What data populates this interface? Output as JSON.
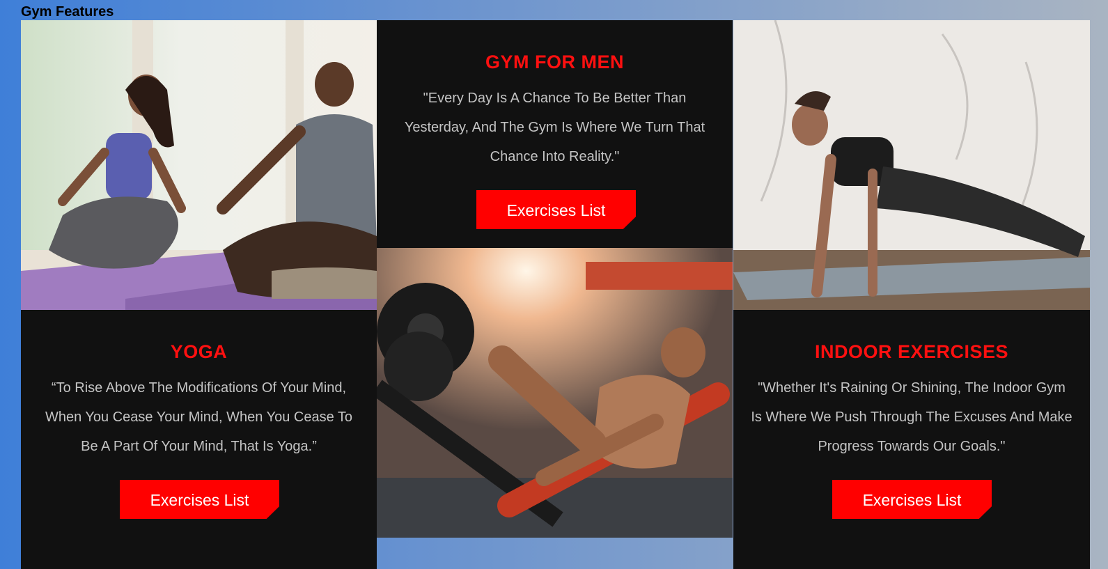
{
  "page": {
    "title": "Gym Features"
  },
  "cards": {
    "gym_for_men": {
      "title": "GYM FOR MEN",
      "quote": "\"Every Day Is A Chance To Be Better Than Yesterday, And The Gym Is Where We Turn That Chance Into Reality.\"",
      "button_label": "Exercises List"
    },
    "yoga": {
      "title": "YOGA",
      "quote": "“To Rise Above The Modifications Of Your Mind, When You Cease Your Mind, When You Cease To Be A Part Of Your Mind, That Is Yoga.”",
      "button_label": "Exercises List"
    },
    "indoor_exercises": {
      "title": "INDOOR EXERCISES",
      "quote": "\"Whether It's Raining Or Shining, The Indoor Gym Is Where We Push Through The Excuses And Make Progress Towards Our Goals.\"",
      "button_label": "Exercises List"
    }
  },
  "images": {
    "yoga_photo": "yoga-couple-meditating-photo",
    "leg_press_photo": "man-on-leg-press-machine-photo",
    "plank_photo": "woman-doing-plank-on-mat-photo"
  },
  "colors": {
    "accent": "#ff0000",
    "card_background": "#111111",
    "body_text": "#c4c4c4"
  }
}
